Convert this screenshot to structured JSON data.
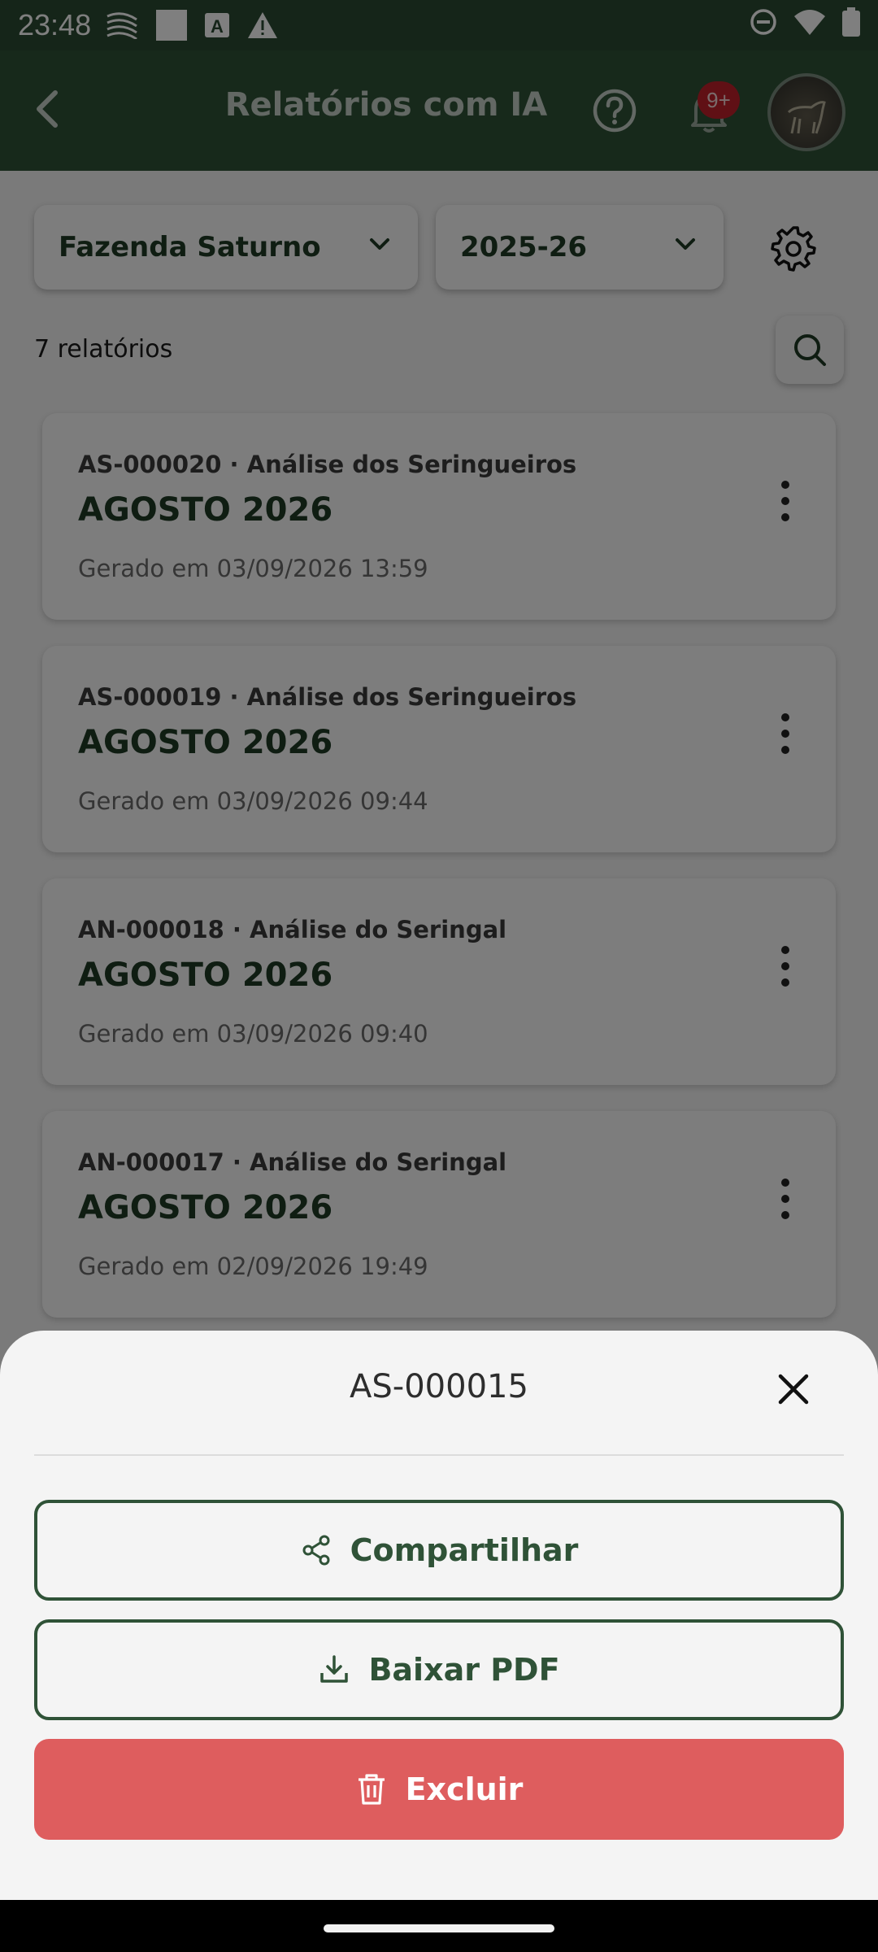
{
  "status_bar": {
    "time": "23:48",
    "icons": [
      "signal-waves-icon",
      "square-icon",
      "a-box-icon",
      "warning-icon",
      "dnd-icon",
      "wifi-icon",
      "battery-icon"
    ]
  },
  "app_bar": {
    "title": "Relatórios com IA",
    "notification_badge": "9+"
  },
  "filters": {
    "farm": "Fazenda Saturno",
    "season": "2025-26"
  },
  "report_count": "7 relatórios",
  "reports": [
    {
      "code": "AS-000020 · Análise dos Seringueiros",
      "period": "AGOSTO 2026",
      "generated": "Gerado em 03/09/2026 13:59"
    },
    {
      "code": "AS-000019 · Análise dos Seringueiros",
      "period": "AGOSTO 2026",
      "generated": "Gerado em 03/09/2026 09:44"
    },
    {
      "code": "AN-000018 · Análise do Seringal",
      "period": "AGOSTO 2026",
      "generated": "Gerado em 03/09/2026 09:40"
    },
    {
      "code": "AN-000017 · Análise do Seringal",
      "period": "AGOSTO 2026",
      "generated": "Gerado em 02/09/2026 19:49"
    }
  ],
  "sheet": {
    "title": "AS-000015",
    "actions": {
      "share": "Compartilhar",
      "pdf": "Baixar PDF",
      "delete": "Excluir"
    }
  },
  "colors": {
    "primary": "#2f5237",
    "danger": "#de5d5e",
    "badge": "#c0202a"
  }
}
